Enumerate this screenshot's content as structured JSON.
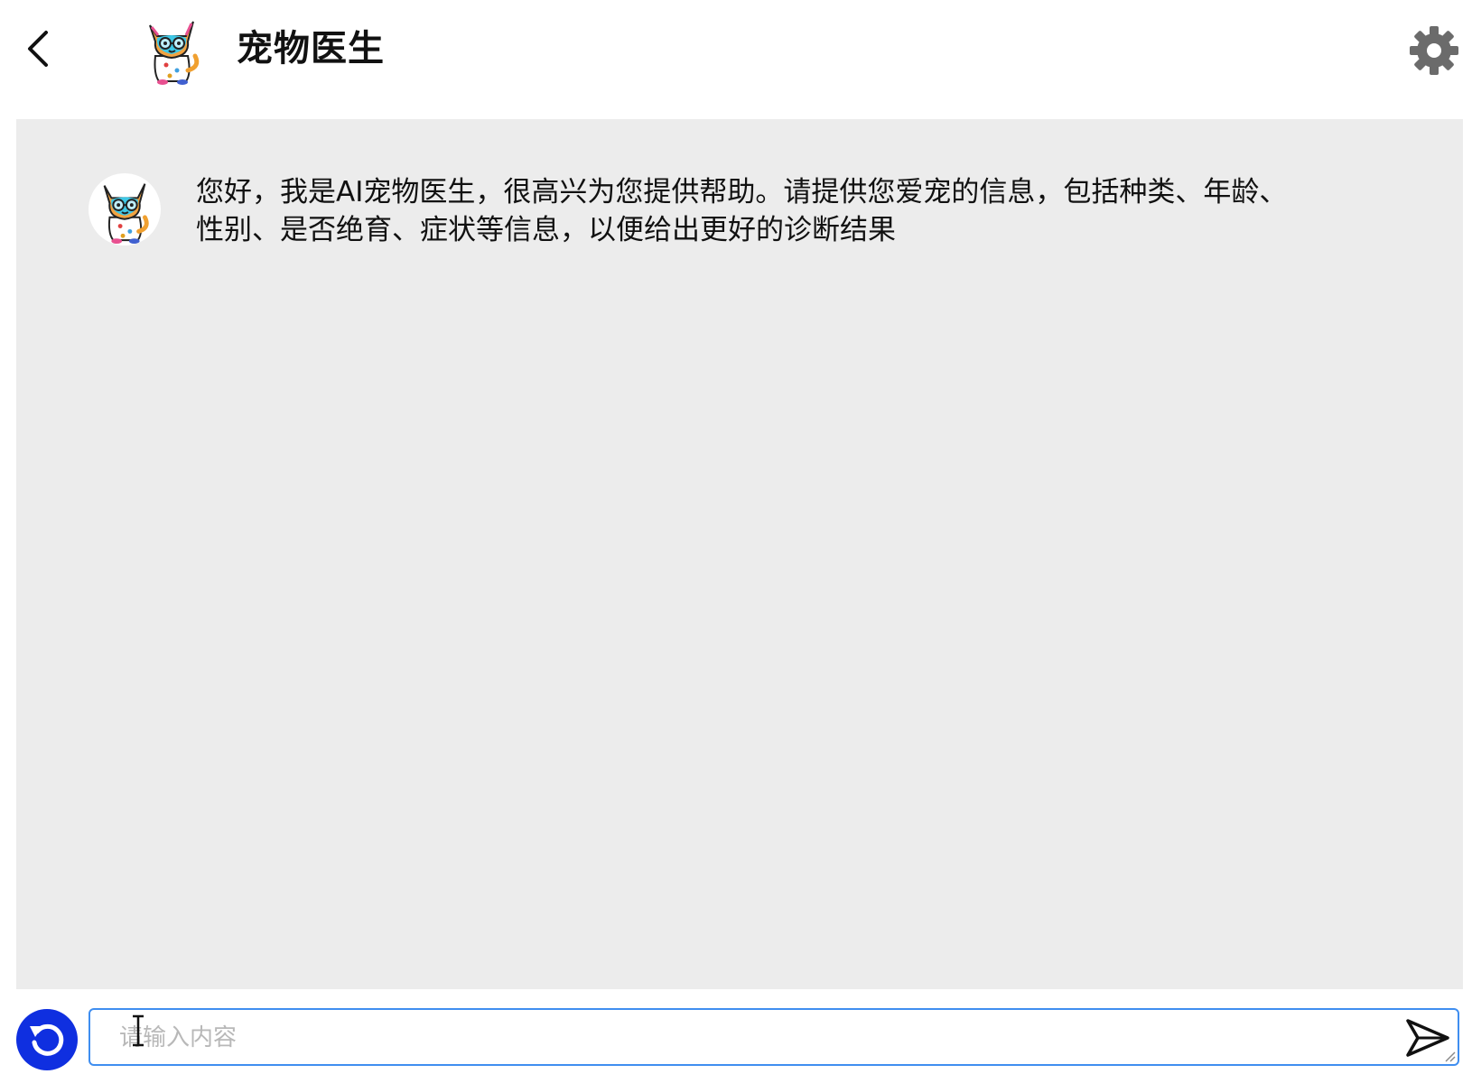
{
  "header": {
    "title": "宠物医生",
    "back_icon": "chevron-left-icon",
    "settings_icon": "gear-icon",
    "avatar": "cat-doctor-avatar"
  },
  "chat": {
    "messages": [
      {
        "sender": "assistant",
        "avatar": "cat-doctor-avatar",
        "text": "您好，我是AI宠物医生，很高兴为您提供帮助。请提供您爱宠的信息，包括种类、年龄、性别、是否绝育、症状等信息，以便给出更好的诊断结果"
      }
    ]
  },
  "composer": {
    "placeholder": "请输入内容",
    "value": "",
    "reset_icon": "refresh-icon",
    "send_icon": "send-icon"
  },
  "colors": {
    "chat_background": "#ececec",
    "reset_button": "#0f2fe0",
    "input_border": "#3f8ef0",
    "gear": "#6b6b6b"
  }
}
